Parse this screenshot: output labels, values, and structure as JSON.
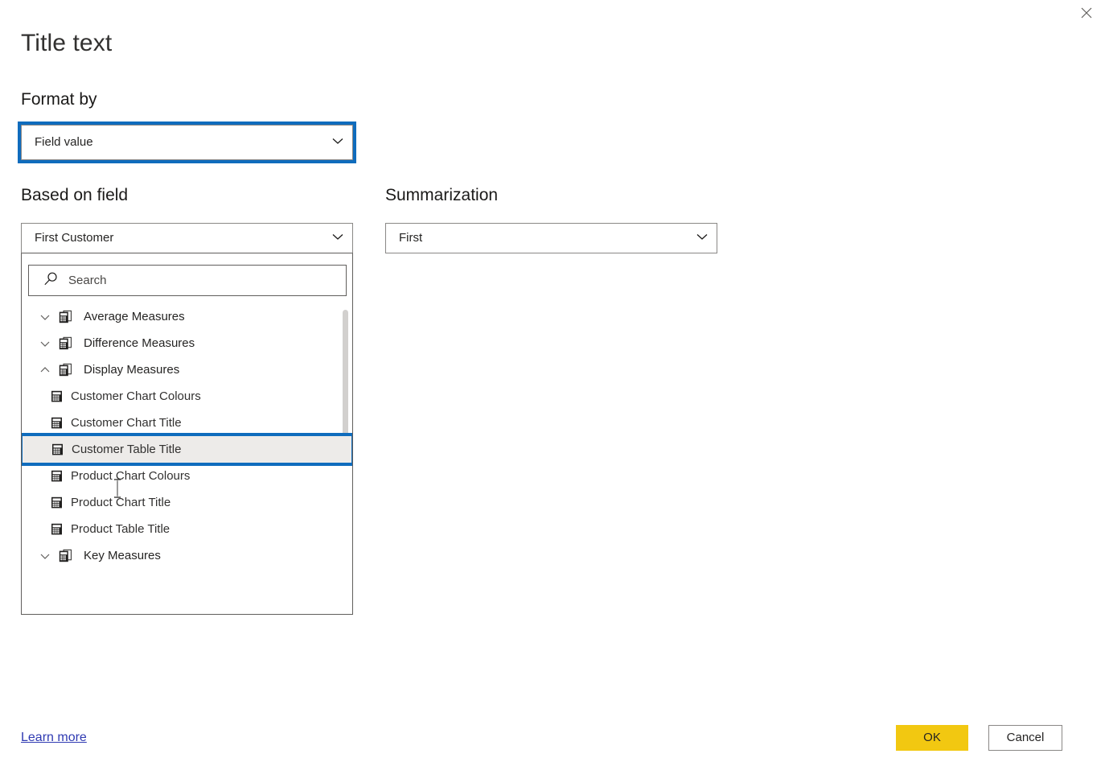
{
  "dialog": {
    "title": "Title text",
    "close_label": "Close",
    "close_icon": "close-icon"
  },
  "format_by": {
    "label": "Format by",
    "value": "Field value",
    "chevron_icon": "chevron-down-icon"
  },
  "based_on_field": {
    "label": "Based on field",
    "value": "First Customer",
    "chevron_icon": "chevron-down-icon",
    "search": {
      "placeholder": "Search",
      "value": "",
      "icon": "search-icon"
    },
    "tree": [
      {
        "label": "Average Measures",
        "level": "group",
        "expanded": false,
        "icon": "measure-table-icon",
        "twisty_icon": "chevron-down-icon",
        "selected": false
      },
      {
        "label": "Difference Measures",
        "level": "group",
        "expanded": false,
        "icon": "measure-table-icon",
        "twisty_icon": "chevron-down-icon",
        "selected": false
      },
      {
        "label": "Display Measures",
        "level": "group",
        "expanded": true,
        "icon": "measure-table-icon",
        "twisty_icon": "chevron-up-icon",
        "selected": false
      },
      {
        "label": "Customer Chart Colours",
        "level": "child",
        "expanded": null,
        "icon": "calculator-icon",
        "twisty_icon": null,
        "selected": false
      },
      {
        "label": "Customer Chart Title",
        "level": "child",
        "expanded": null,
        "icon": "calculator-icon",
        "twisty_icon": null,
        "selected": false
      },
      {
        "label": "Customer Table Title",
        "level": "child",
        "expanded": null,
        "icon": "calculator-icon",
        "twisty_icon": null,
        "selected": true
      },
      {
        "label": "Product Chart Colours",
        "level": "child",
        "expanded": null,
        "icon": "calculator-icon",
        "twisty_icon": null,
        "selected": false
      },
      {
        "label": "Product Chart Title",
        "level": "child",
        "expanded": null,
        "icon": "calculator-icon",
        "twisty_icon": null,
        "selected": false
      },
      {
        "label": "Product Table Title",
        "level": "child",
        "expanded": null,
        "icon": "calculator-icon",
        "twisty_icon": null,
        "selected": false
      },
      {
        "label": "Key Measures",
        "level": "group",
        "expanded": false,
        "icon": "measure-table-icon",
        "twisty_icon": "chevron-down-icon",
        "selected": false
      }
    ]
  },
  "summarization": {
    "label": "Summarization",
    "value": "First",
    "chevron_icon": "chevron-down-icon"
  },
  "footer": {
    "learn_more": "Learn more",
    "ok": "OK",
    "cancel": "Cancel"
  },
  "colors": {
    "accent_blue": "#0f6cbd",
    "ok_yellow": "#f2c811",
    "link_blue": "#2f3ab2",
    "selected_row_bg": "#edebe9",
    "border_gray": "#8a8886",
    "text": "#252423"
  }
}
